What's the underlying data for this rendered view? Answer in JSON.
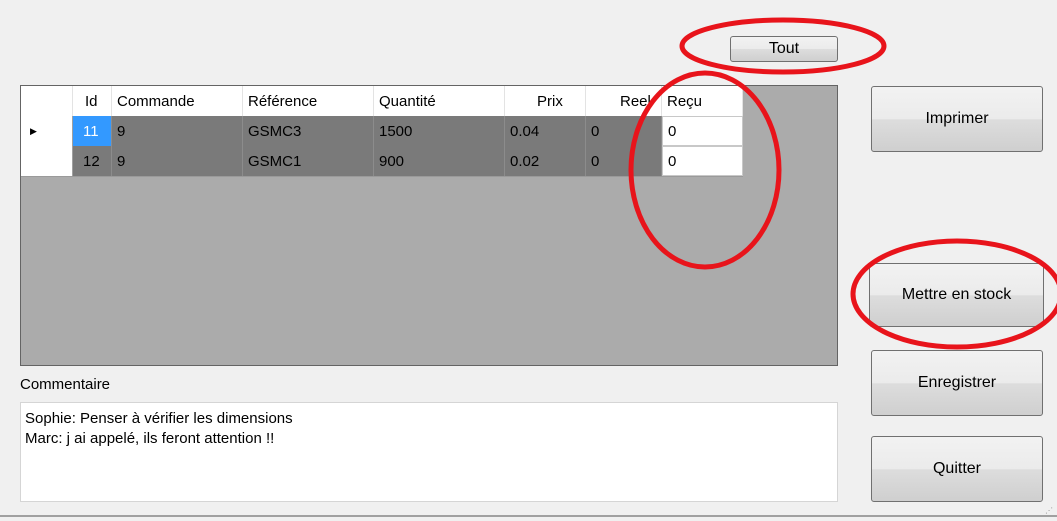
{
  "buttons": {
    "tout": "Tout",
    "imprimer": "Imprimer",
    "mettre_en_stock": "Mettre en stock",
    "enregistrer": "Enregistrer",
    "quitter": "Quitter"
  },
  "grid": {
    "columns": [
      "Id",
      "Commande",
      "Référence",
      "Quantité",
      "Prix",
      "Reel",
      "Reçu"
    ],
    "rows": [
      {
        "id": "11",
        "commande": "9",
        "reference": "GSMC3",
        "quantite": "1500",
        "prix": "0.04",
        "reel": "0",
        "recu": "0"
      },
      {
        "id": "12",
        "commande": "9",
        "reference": "GSMC1",
        "quantite": "900",
        "prix": "0.02",
        "reel": "0",
        "recu": "0"
      }
    ],
    "current_row_marker": "▶"
  },
  "commentaire": {
    "label": "Commentaire",
    "lines": [
      "Sophie: Penser à vérifier les dimensions",
      "Marc: j ai appelé, ils feront attention !!"
    ]
  },
  "annotation_color": "#e8141b"
}
